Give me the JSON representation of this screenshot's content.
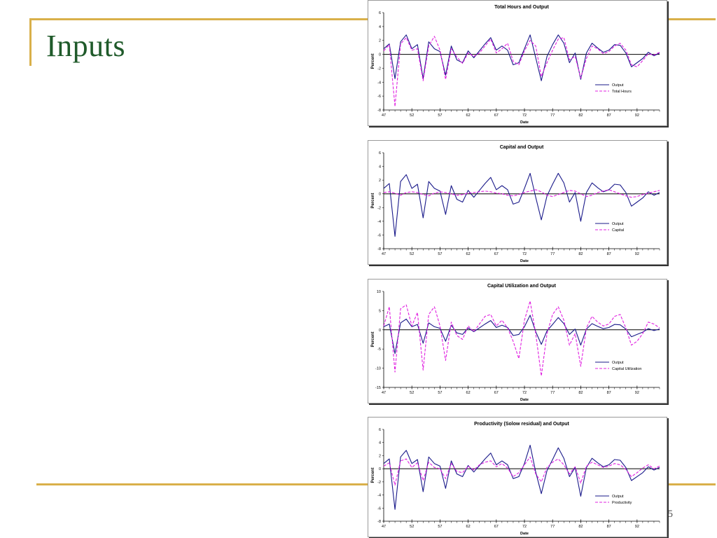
{
  "slide": {
    "title": "Inputs",
    "page_number": "35"
  },
  "theme": {
    "accent": "#d9b04a",
    "title_color": "#1f5a2a",
    "output_color": "#1a1a8a",
    "comparison_color": "#e020e0"
  },
  "chart_data": [
    {
      "type": "line",
      "title": "Total Hours and Output",
      "xlabel": "Date",
      "ylabel": "Percent",
      "ylim": [
        -8,
        6
      ],
      "yticks": [
        6,
        4,
        2,
        0,
        -2,
        -4,
        -6,
        -8
      ],
      "xticks": [
        "47",
        "52",
        "57",
        "62",
        "67",
        "72",
        "77",
        "82",
        "87",
        "92"
      ],
      "x": [
        1947,
        1948,
        1949,
        1950,
        1951,
        1952,
        1953,
        1954,
        1955,
        1956,
        1957,
        1958,
        1959,
        1960,
        1961,
        1962,
        1963,
        1964,
        1965,
        1966,
        1967,
        1968,
        1969,
        1970,
        1971,
        1972,
        1973,
        1974,
        1975,
        1976,
        1977,
        1978,
        1979,
        1980,
        1981,
        1982,
        1983,
        1984,
        1985,
        1986,
        1987,
        1988,
        1989,
        1990,
        1991,
        1992,
        1993,
        1994,
        1995,
        1996
      ],
      "legend_position": "right",
      "series": [
        {
          "name": "Output",
          "style": "solid",
          "values": [
            0.8,
            1.5,
            -3.5,
            1.8,
            2.8,
            0.8,
            1.4,
            -3.5,
            1.8,
            0.8,
            0.4,
            -3.0,
            1.2,
            -0.8,
            -1.2,
            0.5,
            -0.5,
            0.5,
            1.5,
            2.4,
            0.6,
            1.2,
            0.6,
            -1.5,
            -1.2,
            0.8,
            2.8,
            -0.5,
            -3.8,
            -0.3,
            1.4,
            2.8,
            1.6,
            -1.2,
            0.2,
            -3.6,
            0.2,
            1.6,
            0.9,
            0.3,
            0.6,
            1.4,
            1.3,
            0.2,
            -1.8,
            -1.2,
            -0.6,
            0.3,
            -0.2,
            0.2
          ]
        },
        {
          "name": "Total Hours",
          "style": "dashed",
          "values": [
            0.5,
            1.4,
            -7.5,
            1.5,
            2.4,
            0.6,
            0.8,
            -3.8,
            1.2,
            2.6,
            0.6,
            -3.6,
            0.8,
            -0.4,
            -1.3,
            0.2,
            -0.3,
            0.2,
            1.2,
            2.2,
            0.2,
            0.8,
            1.6,
            -1.0,
            -1.5,
            0.5,
            2.0,
            1.2,
            -3.2,
            -1.2,
            0.6,
            2.2,
            2.4,
            -0.8,
            -0.3,
            -3.4,
            -0.6,
            1.2,
            0.8,
            0.1,
            0.4,
            1.2,
            1.6,
            0.6,
            -1.5,
            -1.8,
            -0.9,
            0.1,
            -0.1,
            0.3
          ]
        }
      ]
    },
    {
      "type": "line",
      "title": "Capital and Output",
      "xlabel": "Date",
      "ylabel": "Percent",
      "ylim": [
        -8,
        6
      ],
      "yticks": [
        6,
        4,
        2,
        0,
        -2,
        -4,
        -6,
        -8
      ],
      "xticks": [
        "47",
        "52",
        "57",
        "62",
        "67",
        "72",
        "77",
        "82",
        "87",
        "92"
      ],
      "x": [
        1947,
        1948,
        1949,
        1950,
        1951,
        1952,
        1953,
        1954,
        1955,
        1956,
        1957,
        1958,
        1959,
        1960,
        1961,
        1962,
        1963,
        1964,
        1965,
        1966,
        1967,
        1968,
        1969,
        1970,
        1971,
        1972,
        1973,
        1974,
        1975,
        1976,
        1977,
        1978,
        1979,
        1980,
        1981,
        1982,
        1983,
        1984,
        1985,
        1986,
        1987,
        1988,
        1989,
        1990,
        1991,
        1992,
        1993,
        1994,
        1995,
        1996
      ],
      "legend_position": "right",
      "series": [
        {
          "name": "Output",
          "style": "solid",
          "values": [
            0.8,
            1.5,
            -6.2,
            1.8,
            2.8,
            0.8,
            1.4,
            -3.5,
            1.8,
            0.8,
            0.4,
            -3.0,
            1.2,
            -0.8,
            -1.2,
            0.5,
            -0.5,
            0.5,
            1.5,
            2.4,
            0.6,
            1.2,
            0.6,
            -1.5,
            -1.2,
            0.8,
            3.0,
            -0.5,
            -3.8,
            -0.3,
            1.4,
            3.0,
            1.6,
            -1.2,
            0.2,
            -4.0,
            0.2,
            1.6,
            0.9,
            0.3,
            0.6,
            1.4,
            1.3,
            0.2,
            -1.8,
            -1.2,
            -0.6,
            0.3,
            -0.2,
            0.2
          ]
        },
        {
          "name": "Capital",
          "style": "dashed",
          "values": [
            0.2,
            0.3,
            0.1,
            -0.2,
            0.2,
            0.3,
            0.2,
            -0.1,
            -0.3,
            0.1,
            0.3,
            0.2,
            0.0,
            -0.2,
            -0.1,
            0.1,
            0.2,
            0.3,
            0.4,
            0.3,
            0.1,
            0.0,
            -0.2,
            -0.3,
            -0.1,
            0.2,
            0.4,
            0.6,
            0.3,
            -0.2,
            -0.4,
            -0.1,
            0.2,
            0.5,
            0.4,
            0.0,
            -0.4,
            -0.2,
            0.2,
            0.4,
            0.6,
            0.3,
            0.0,
            -0.3,
            -0.5,
            -0.4,
            -0.1,
            0.1,
            0.3,
            0.5
          ]
        }
      ]
    },
    {
      "type": "line",
      "title": "Capital Utilization and Output",
      "xlabel": "Date",
      "ylabel": "Percent",
      "ylim": [
        -15,
        10
      ],
      "yticks": [
        10,
        5,
        0,
        -5,
        -10,
        -15
      ],
      "xticks": [
        "47",
        "52",
        "57",
        "62",
        "67",
        "72",
        "77",
        "82",
        "87",
        "92"
      ],
      "x": [
        1947,
        1948,
        1949,
        1950,
        1951,
        1952,
        1953,
        1954,
        1955,
        1956,
        1957,
        1958,
        1959,
        1960,
        1961,
        1962,
        1963,
        1964,
        1965,
        1966,
        1967,
        1968,
        1969,
        1970,
        1971,
        1972,
        1973,
        1974,
        1975,
        1976,
        1977,
        1978,
        1979,
        1980,
        1981,
        1982,
        1983,
        1984,
        1985,
        1986,
        1987,
        1988,
        1989,
        1990,
        1991,
        1992,
        1993,
        1994,
        1995,
        1996
      ],
      "legend_position": "right",
      "series": [
        {
          "name": "Output",
          "style": "solid",
          "values": [
            0.8,
            1.5,
            -6.2,
            1.8,
            2.8,
            0.8,
            1.4,
            -3.5,
            1.8,
            0.8,
            0.4,
            -3.0,
            1.2,
            -0.8,
            -1.2,
            0.5,
            -0.5,
            0.5,
            1.5,
            2.4,
            0.6,
            1.2,
            0.6,
            -1.5,
            -1.2,
            0.8,
            3.8,
            -0.5,
            -3.8,
            -0.3,
            1.4,
            3.2,
            1.6,
            -1.2,
            0.2,
            -4.0,
            0.2,
            1.6,
            0.9,
            0.3,
            0.6,
            1.4,
            1.3,
            0.2,
            -1.8,
            -1.2,
            -0.6,
            0.3,
            -0.2,
            0.2
          ]
        },
        {
          "name": "Capital Utilization",
          "style": "dashed",
          "values": [
            1.0,
            6.0,
            -11.0,
            5.5,
            6.5,
            1.0,
            4.5,
            -10.5,
            4.0,
            6.0,
            1.0,
            -8.0,
            2.0,
            -1.5,
            -2.5,
            1.0,
            -0.5,
            1.5,
            3.5,
            4.0,
            1.0,
            2.5,
            0.5,
            -3.0,
            -7.5,
            2.5,
            7.5,
            -1.0,
            -12.0,
            -1.0,
            4.0,
            6.0,
            2.5,
            -4.0,
            -1.0,
            -9.5,
            0.5,
            3.5,
            2.0,
            1.0,
            1.5,
            3.5,
            4.0,
            0.5,
            -4.0,
            -3.0,
            -1.0,
            2.0,
            1.5,
            0.5
          ]
        }
      ]
    },
    {
      "type": "line",
      "title": "Productivity (Solow residual) and Output",
      "xlabel": "Date",
      "ylabel": "Percent",
      "ylim": [
        -8,
        6
      ],
      "yticks": [
        6,
        4,
        2,
        0,
        -2,
        -4,
        -6,
        -8
      ],
      "xticks": [
        "47",
        "52",
        "57",
        "62",
        "67",
        "72",
        "77",
        "82",
        "87",
        "92"
      ],
      "x": [
        1947,
        1948,
        1949,
        1950,
        1951,
        1952,
        1953,
        1954,
        1955,
        1956,
        1957,
        1958,
        1959,
        1960,
        1961,
        1962,
        1963,
        1964,
        1965,
        1966,
        1967,
        1968,
        1969,
        1970,
        1971,
        1972,
        1973,
        1974,
        1975,
        1976,
        1977,
        1978,
        1979,
        1980,
        1981,
        1982,
        1983,
        1984,
        1985,
        1986,
        1987,
        1988,
        1989,
        1990,
        1991,
        1992,
        1993,
        1994,
        1995,
        1996
      ],
      "legend_position": "right",
      "series": [
        {
          "name": "Output",
          "style": "solid",
          "values": [
            0.8,
            1.5,
            -6.2,
            1.8,
            2.8,
            0.8,
            1.4,
            -3.5,
            1.8,
            0.8,
            0.4,
            -3.0,
            1.2,
            -0.8,
            -1.2,
            0.5,
            -0.5,
            0.5,
            1.5,
            2.4,
            0.6,
            1.2,
            0.6,
            -1.5,
            -1.2,
            0.8,
            3.6,
            -0.5,
            -3.8,
            -0.3,
            1.4,
            3.2,
            1.6,
            -1.2,
            0.2,
            -4.2,
            0.2,
            1.6,
            0.9,
            0.3,
            0.6,
            1.4,
            1.3,
            0.2,
            -1.8,
            -1.2,
            -0.6,
            0.3,
            -0.2,
            0.2
          ]
        },
        {
          "name": "Productivity",
          "style": "dashed",
          "values": [
            0.4,
            0.9,
            -2.5,
            1.2,
            1.5,
            0.2,
            0.9,
            -1.8,
            1.0,
            0.2,
            0.0,
            -1.5,
            0.8,
            -0.4,
            -0.6,
            0.4,
            -0.2,
            0.6,
            1.0,
            1.2,
            0.3,
            0.8,
            0.1,
            -1.2,
            -0.6,
            0.6,
            1.8,
            -0.8,
            -2.0,
            0.2,
            1.0,
            1.5,
            0.6,
            -0.8,
            0.3,
            -2.2,
            0.4,
            1.0,
            0.6,
            0.2,
            0.4,
            0.8,
            0.6,
            -0.1,
            -1.2,
            -0.6,
            0.1,
            0.6,
            0.0,
            0.4
          ]
        }
      ]
    }
  ]
}
